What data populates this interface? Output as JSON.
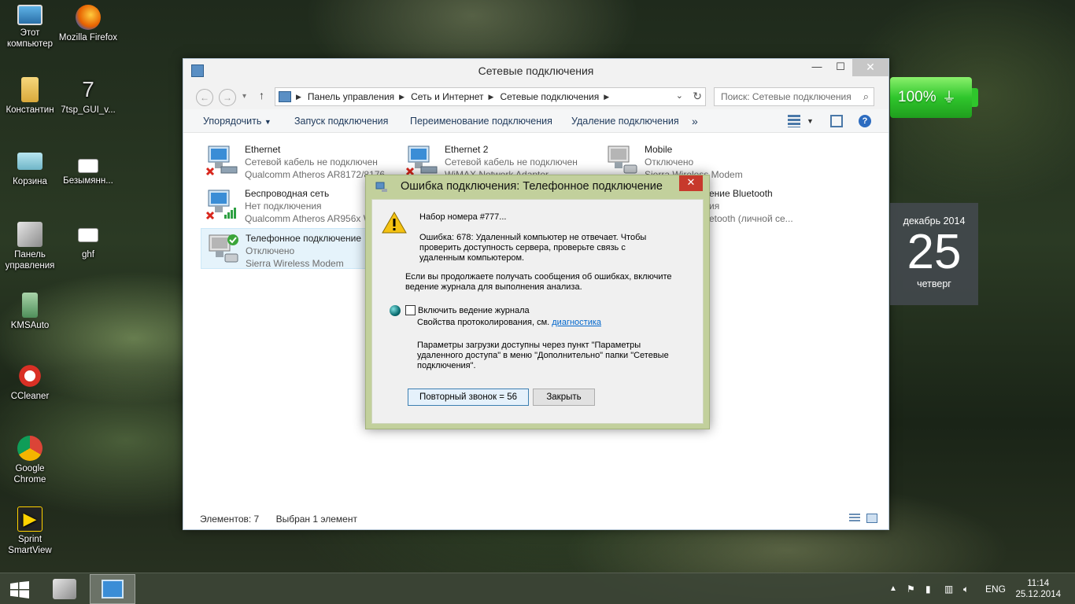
{
  "desktop": {
    "icons": [
      {
        "label": "Этот компьютер",
        "icon": "computer-icon"
      },
      {
        "label": "Mozilla Firefox",
        "icon": "firefox-icon"
      },
      {
        "label": "Константин",
        "icon": "user-folder-icon"
      },
      {
        "label": "7tsp_GUI_v...",
        "icon": "app-icon"
      },
      {
        "label": "Корзина",
        "icon": "recycle-bin-icon"
      },
      {
        "label": "Безымянн...",
        "icon": "image-file-icon"
      },
      {
        "label": "Панель управления",
        "icon": "control-panel-icon"
      },
      {
        "label": "ghf",
        "icon": "image-file-icon"
      },
      {
        "label": "KMSAuto",
        "icon": "kmsauto-icon"
      },
      {
        "label": "CCleaner",
        "icon": "ccleaner-icon"
      },
      {
        "label": "Google Chrome",
        "icon": "chrome-icon"
      },
      {
        "label": "Sprint SmartView",
        "icon": "sprint-icon"
      }
    ]
  },
  "window": {
    "title": "Сетевые подключения",
    "controls": {
      "minimize": "—",
      "maximize": "☐",
      "close": "✕"
    },
    "breadcrumbs": [
      "Панель управления",
      "Сеть и Интернет",
      "Сетевые подключения"
    ],
    "search_placeholder": "Поиск: Сетевые подключения",
    "toolbar": {
      "organize": "Упорядочить",
      "start": "Запуск подключения",
      "rename": "Переименование подключения",
      "delete": "Удаление подключения",
      "more": "»"
    },
    "connections": [
      {
        "name": "Ethernet",
        "status": "Сетевой кабель не подключен",
        "device": "Qualcomm Atheros AR8172/8176..."
      },
      {
        "name": "Ethernet 2",
        "status": "Сетевой кабель не подключен",
        "device": "WiMAX Network Adapter"
      },
      {
        "name": "Mobile",
        "status": "Отключено",
        "device": "Sierra Wireless Modem"
      },
      {
        "name": "Беспроводная сеть",
        "status": "Нет подключения",
        "device": "Qualcomm Atheros AR956x Wi..."
      },
      {
        "name": "...ение Bluetooth",
        "status": "...ия",
        "device": "...etooth (личной се..."
      },
      {
        "name": "Телефонное подключение",
        "status": "Отключено",
        "device": "Sierra Wireless Modem"
      }
    ],
    "status": {
      "count": "Элементов: 7",
      "selected": "Выбран 1 элемент"
    }
  },
  "dialog": {
    "title": "Ошибка подключения: Телефонное подключение",
    "close": "✕",
    "dialing": "Набор номера #777...",
    "error": "Ошибка: 678: Удаленный компьютер не отвечает. Чтобы проверить доступность сервера, проверьте связь с удаленным компьютером.",
    "hint": "Если вы продолжаете получать сообщения об ошибках, включите ведение журнала для выполнения анализа.",
    "checkbox_label": "Включить ведение журнала",
    "props_text": "Свойства протоколирования, см.",
    "props_link": "диагностика",
    "params": "Параметры загрузки доступны через пункт \"Параметры удаленного доступа\" в меню \"Дополнительно\" папки \"Сетевые подключения\".",
    "redial_button": "Повторный звонок = 56",
    "close_button": "Закрыть"
  },
  "widgets": {
    "battery": "100%",
    "calendar": {
      "month": "декабрь 2014",
      "day": "25",
      "weekday": "четверг"
    }
  },
  "taskbar": {
    "language": "ENG",
    "time": "11:14",
    "date": "25.12.2014"
  },
  "colors": {
    "accent": "#1e395b",
    "dialog_frame": "#c2d09c",
    "close_red": "#c7392c",
    "battery_green": "#2fc62c",
    "link": "#0066cc"
  }
}
